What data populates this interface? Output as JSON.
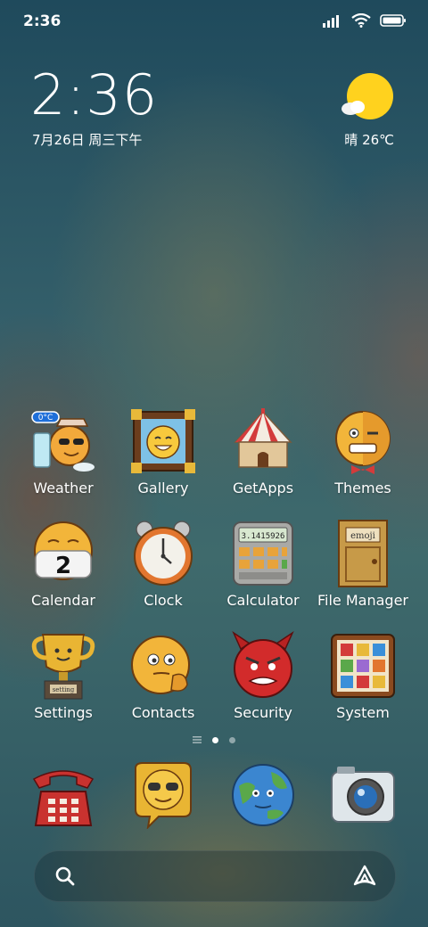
{
  "status": {
    "time": "2:36"
  },
  "widget": {
    "clock": "2:36",
    "date": "7月26日 周三下午",
    "weather": "晴 26℃"
  },
  "apps": [
    {
      "name": "Weather",
      "badge": "0°C"
    },
    {
      "name": "Gallery"
    },
    {
      "name": "GetApps"
    },
    {
      "name": "Themes"
    },
    {
      "name": "Calendar",
      "day": "2"
    },
    {
      "name": "Clock"
    },
    {
      "name": "Calculator",
      "display": "3.1415926"
    },
    {
      "name": "File Manager",
      "door_text": "emoji"
    },
    {
      "name": "Settings",
      "plaque": "setting"
    },
    {
      "name": "Contacts"
    },
    {
      "name": "Security"
    },
    {
      "name": "System"
    }
  ],
  "dock": [
    "phone-icon",
    "messages-icon",
    "browser-icon",
    "camera-icon"
  ],
  "colors": {
    "sun": "#FFD21E",
    "accent": "#F2B53A"
  }
}
